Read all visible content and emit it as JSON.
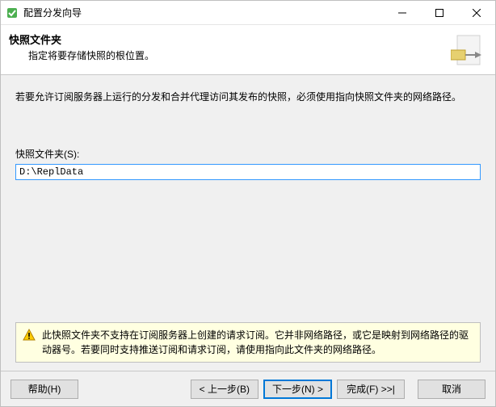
{
  "window": {
    "title": "配置分发向导"
  },
  "header": {
    "title": "快照文件夹",
    "subtitle": "指定将要存储快照的根位置。"
  },
  "main": {
    "instruction": "若要允许订阅服务器上运行的分发和合并代理访问其发布的快照，必须使用指向快照文件夹的网络路径。",
    "field_label": "快照文件夹(S):",
    "field_value": "D:\\ReplData"
  },
  "warning": {
    "text": "此快照文件夹不支持在订阅服务器上创建的请求订阅。它并非网络路径，或它是映射到网络路径的驱动器号。若要同时支持推送订阅和请求订阅，请使用指向此文件夹的网络路径。"
  },
  "buttons": {
    "help": "帮助(H)",
    "back": "< 上一步(B)",
    "next": "下一步(N) >",
    "finish": "完成(F) >>|",
    "cancel": "取消"
  }
}
